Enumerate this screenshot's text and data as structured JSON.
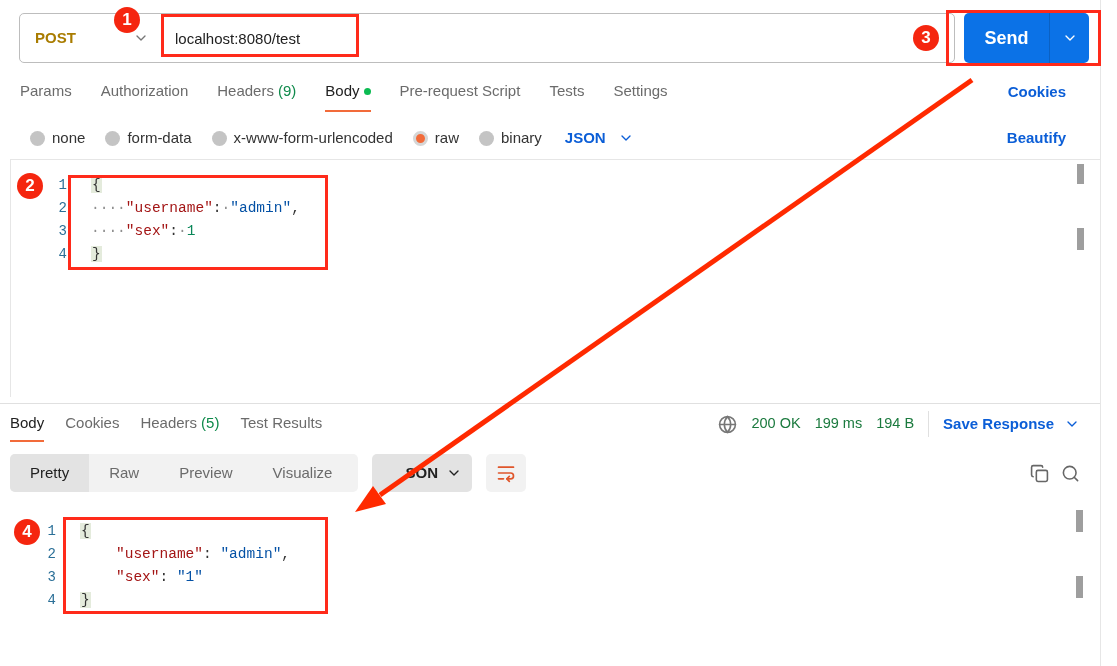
{
  "request": {
    "method": "POST",
    "url": "localhost:8080/test",
    "send_label": "Send"
  },
  "request_tabs": [
    {
      "label": "Params",
      "selected": false,
      "dot": false
    },
    {
      "label": "Authorization",
      "selected": false,
      "dot": false
    },
    {
      "label": "Headers",
      "count": "(9)",
      "selected": false,
      "dot": false
    },
    {
      "label": "Body",
      "selected": true,
      "dot": true
    },
    {
      "label": "Pre-request Script",
      "selected": false,
      "dot": false
    },
    {
      "label": "Tests",
      "selected": false,
      "dot": false
    },
    {
      "label": "Settings",
      "selected": false,
      "dot": false
    }
  ],
  "cookies_link": "Cookies",
  "body_types": [
    {
      "label": "none",
      "selected": false
    },
    {
      "label": "form-data",
      "selected": false
    },
    {
      "label": "x-www-form-urlencoded",
      "selected": false
    },
    {
      "label": "raw",
      "selected": true
    },
    {
      "label": "binary",
      "selected": false
    }
  ],
  "body_language": "JSON",
  "beautify": "Beautify",
  "request_body": [
    {
      "number": "1",
      "tokens": [
        {
          "kind": "brace",
          "text": "{"
        }
      ]
    },
    {
      "number": "2",
      "tokens": [
        {
          "kind": "ws",
          "text": "····"
        },
        {
          "kind": "key",
          "text": "\"username\""
        },
        {
          "kind": "punct",
          "text": ":"
        },
        {
          "kind": "ws",
          "text": "·"
        },
        {
          "kind": "string",
          "text": "\"admin\""
        },
        {
          "kind": "punct",
          "text": ","
        }
      ]
    },
    {
      "number": "3",
      "tokens": [
        {
          "kind": "ws",
          "text": "····"
        },
        {
          "kind": "key",
          "text": "\"sex\""
        },
        {
          "kind": "punct",
          "text": ":"
        },
        {
          "kind": "ws",
          "text": "·"
        },
        {
          "kind": "number",
          "text": "1"
        }
      ]
    },
    {
      "number": "4",
      "tokens": [
        {
          "kind": "brace",
          "text": "}"
        }
      ]
    }
  ],
  "response_tabs": [
    {
      "label": "Body",
      "selected": true
    },
    {
      "label": "Cookies",
      "selected": false
    },
    {
      "label": "Headers",
      "count": "(5)",
      "selected": false
    },
    {
      "label": "Test Results",
      "selected": false
    }
  ],
  "response_status": {
    "status": "200 OK",
    "time": "199 ms",
    "size": "194 B"
  },
  "save_response": "Save Response",
  "view_modes": [
    {
      "label": "Pretty",
      "selected": true
    },
    {
      "label": "Raw",
      "selected": false
    },
    {
      "label": "Preview",
      "selected": false
    },
    {
      "label": "Visualize",
      "selected": false
    }
  ],
  "response_language": "SON",
  "response_body": [
    {
      "number": "1",
      "tokens": [
        {
          "kind": "brace",
          "text": "{"
        }
      ]
    },
    {
      "number": "2",
      "kind": "member",
      "tokens": [
        {
          "kind": "key",
          "text": "\"username\""
        },
        {
          "kind": "punct",
          "text": ": "
        },
        {
          "kind": "string",
          "text": "\"admin\""
        },
        {
          "kind": "punct",
          "text": ","
        }
      ]
    },
    {
      "number": "3",
      "kind": "member",
      "tokens": [
        {
          "kind": "key",
          "text": "\"sex\""
        },
        {
          "kind": "punct",
          "text": ": "
        },
        {
          "kind": "string",
          "text": "\"1\""
        }
      ]
    },
    {
      "number": "4",
      "tokens": [
        {
          "kind": "brace",
          "text": "}"
        }
      ]
    }
  ],
  "annotations": [
    {
      "number": "1"
    },
    {
      "number": "2"
    },
    {
      "number": "3"
    },
    {
      "number": "4"
    }
  ]
}
